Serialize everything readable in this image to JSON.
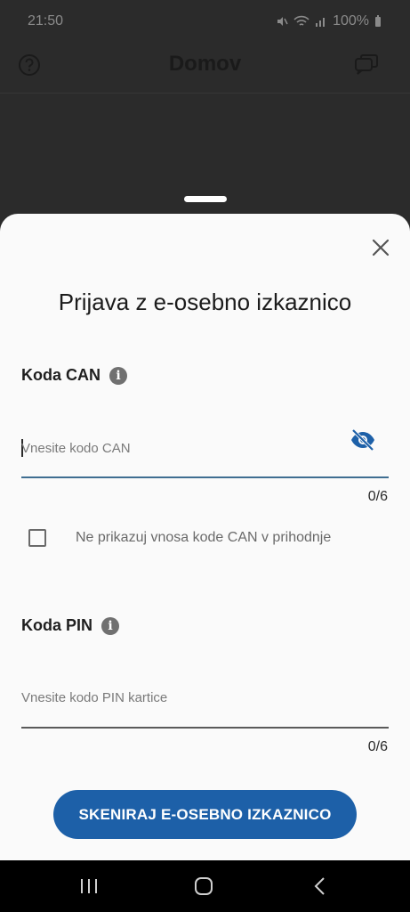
{
  "status_bar": {
    "time": "21:50",
    "battery": "100%"
  },
  "background": {
    "title": "Domov"
  },
  "sheet": {
    "title": "Prijava z e-osebno izkaznico",
    "can": {
      "label": "Koda CAN",
      "placeholder": "Vnesite kodo CAN",
      "counter": "0/6"
    },
    "checkbox": {
      "label": "Ne prikazuj vnosa kode CAN v prihodnje"
    },
    "pin": {
      "label": "Koda PIN",
      "placeholder": "Vnesite kodo PIN kartice",
      "counter": "0/6"
    },
    "scan_button": "SKENIRAJ E-OSEBNO IZKAZNICO"
  },
  "icons": {
    "help": "help-icon",
    "chat": "chat-icon",
    "close": "close-icon",
    "info": "info-icon",
    "visibility_off": "eye-off-icon"
  },
  "colors": {
    "accent": "#1d60a8",
    "input_underline_active": "#3f6e91",
    "sheet_bg": "#fafafa",
    "scrim": "#2b2b2b"
  }
}
